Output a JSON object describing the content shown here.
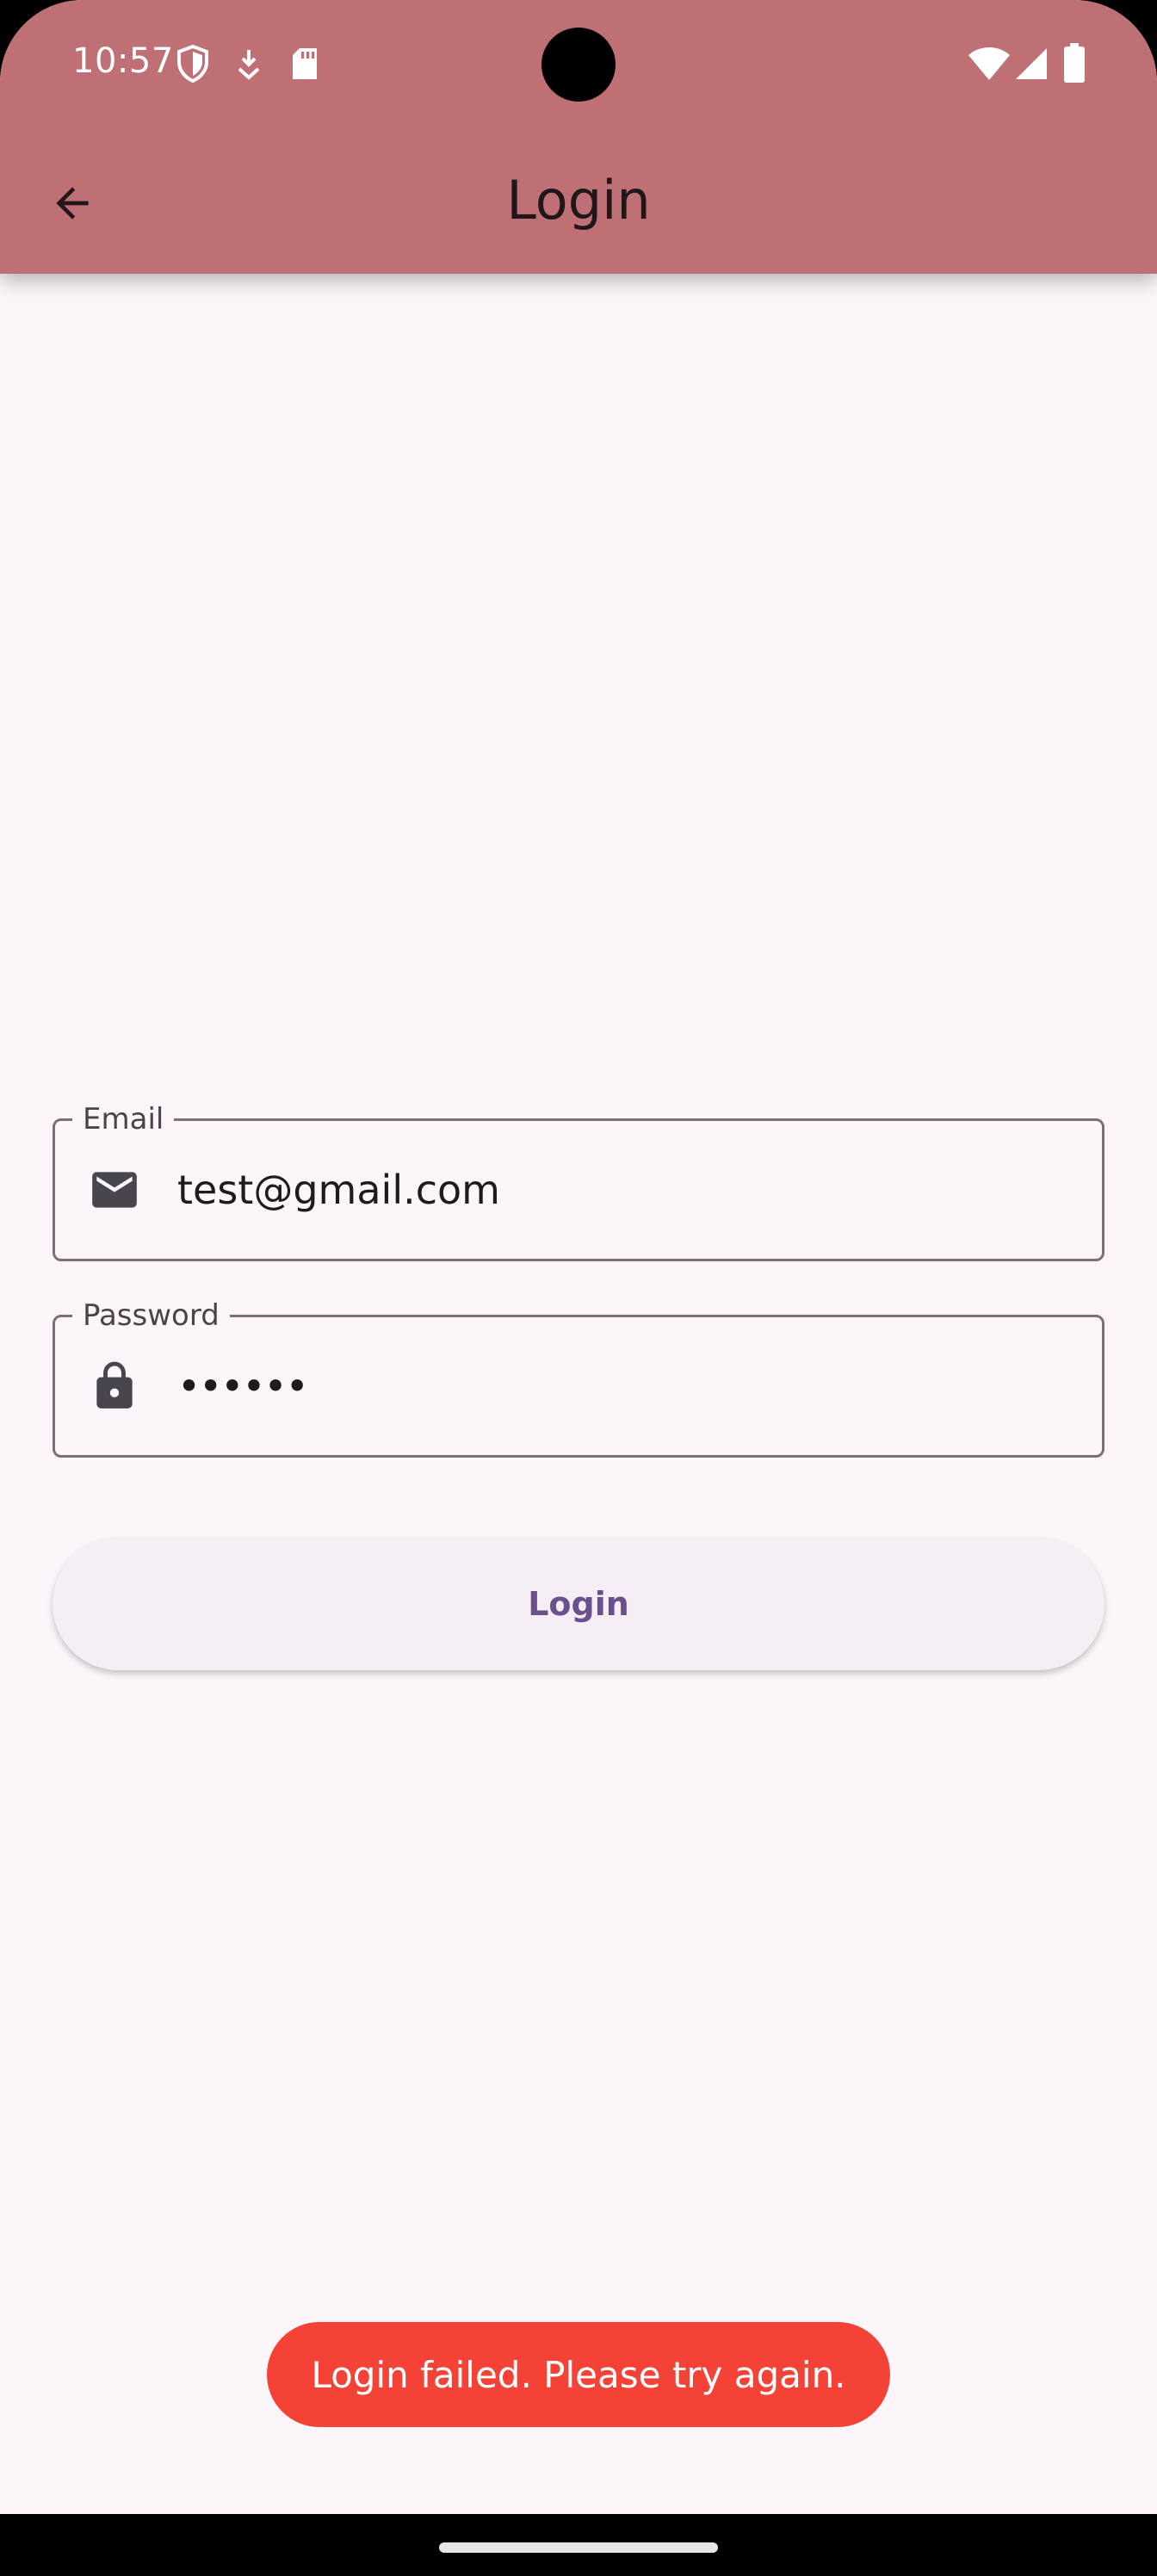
{
  "status_bar": {
    "time": "10:57",
    "left_icons": [
      "shield-icon",
      "download-icon",
      "sd-card-icon"
    ],
    "right_icons": [
      "wifi-icon",
      "signal-icon",
      "battery-icon"
    ]
  },
  "app_bar": {
    "title": "Login",
    "back_icon": "arrow-back-icon",
    "color": "#bf7075"
  },
  "form": {
    "email": {
      "label": "Email",
      "value": "test@gmail.com",
      "icon": "mail-icon"
    },
    "password": {
      "label": "Password",
      "value": "••••••",
      "icon": "lock-icon"
    },
    "submit_label": "Login"
  },
  "toast": {
    "message": "Login failed. Please try again.",
    "color": "#f44336"
  }
}
